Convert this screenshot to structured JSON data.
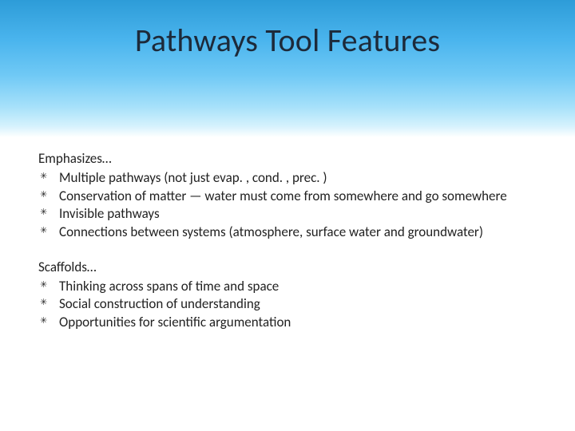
{
  "title": "Pathways Tool Features",
  "sections": [
    {
      "intro": "Emphasizes…",
      "items": [
        "Multiple pathways (not just evap. , cond. , prec. )",
        "Conservation of matter — water must come from somewhere and go somewhere",
        "Invisible pathways",
        "Connections between systems (atmosphere, surface water and groundwater)"
      ]
    },
    {
      "intro": "Scaffolds…",
      "items": [
        "Thinking across spans of time and space",
        "Social construction of understanding",
        "Opportunities for scientific argumentation"
      ]
    }
  ]
}
